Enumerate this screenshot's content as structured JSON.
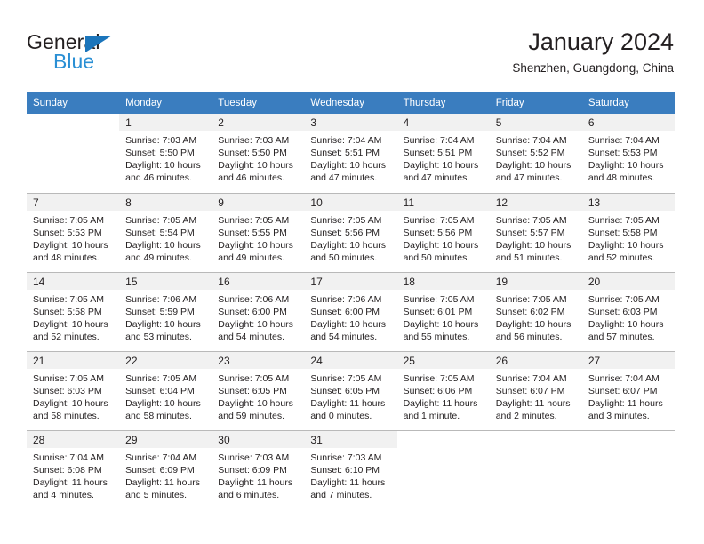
{
  "brand": {
    "name_dark": "General",
    "name_blue": "Blue",
    "accent_blue": "#2a8fd4",
    "triangle_blue": "#1b75bb"
  },
  "header": {
    "title": "January 2024",
    "location": "Shenzhen, Guangdong, China",
    "header_bg": "#3a7dbf",
    "daynum_bg": "#f1f1f1"
  },
  "weekdays": [
    "Sunday",
    "Monday",
    "Tuesday",
    "Wednesday",
    "Thursday",
    "Friday",
    "Saturday"
  ],
  "labels": {
    "sunrise_prefix": "Sunrise: ",
    "sunset_prefix": "Sunset: ",
    "daylight_prefix": "Daylight: "
  },
  "weeks": [
    [
      {
        "day": "",
        "sunrise": "",
        "sunset": "",
        "daylight": ""
      },
      {
        "day": "1",
        "sunrise": "Sunrise: 7:03 AM",
        "sunset": "Sunset: 5:50 PM",
        "daylight": "Daylight: 10 hours and 46 minutes."
      },
      {
        "day": "2",
        "sunrise": "Sunrise: 7:03 AM",
        "sunset": "Sunset: 5:50 PM",
        "daylight": "Daylight: 10 hours and 46 minutes."
      },
      {
        "day": "3",
        "sunrise": "Sunrise: 7:04 AM",
        "sunset": "Sunset: 5:51 PM",
        "daylight": "Daylight: 10 hours and 47 minutes."
      },
      {
        "day": "4",
        "sunrise": "Sunrise: 7:04 AM",
        "sunset": "Sunset: 5:51 PM",
        "daylight": "Daylight: 10 hours and 47 minutes."
      },
      {
        "day": "5",
        "sunrise": "Sunrise: 7:04 AM",
        "sunset": "Sunset: 5:52 PM",
        "daylight": "Daylight: 10 hours and 47 minutes."
      },
      {
        "day": "6",
        "sunrise": "Sunrise: 7:04 AM",
        "sunset": "Sunset: 5:53 PM",
        "daylight": "Daylight: 10 hours and 48 minutes."
      }
    ],
    [
      {
        "day": "7",
        "sunrise": "Sunrise: 7:05 AM",
        "sunset": "Sunset: 5:53 PM",
        "daylight": "Daylight: 10 hours and 48 minutes."
      },
      {
        "day": "8",
        "sunrise": "Sunrise: 7:05 AM",
        "sunset": "Sunset: 5:54 PM",
        "daylight": "Daylight: 10 hours and 49 minutes."
      },
      {
        "day": "9",
        "sunrise": "Sunrise: 7:05 AM",
        "sunset": "Sunset: 5:55 PM",
        "daylight": "Daylight: 10 hours and 49 minutes."
      },
      {
        "day": "10",
        "sunrise": "Sunrise: 7:05 AM",
        "sunset": "Sunset: 5:56 PM",
        "daylight": "Daylight: 10 hours and 50 minutes."
      },
      {
        "day": "11",
        "sunrise": "Sunrise: 7:05 AM",
        "sunset": "Sunset: 5:56 PM",
        "daylight": "Daylight: 10 hours and 50 minutes."
      },
      {
        "day": "12",
        "sunrise": "Sunrise: 7:05 AM",
        "sunset": "Sunset: 5:57 PM",
        "daylight": "Daylight: 10 hours and 51 minutes."
      },
      {
        "day": "13",
        "sunrise": "Sunrise: 7:05 AM",
        "sunset": "Sunset: 5:58 PM",
        "daylight": "Daylight: 10 hours and 52 minutes."
      }
    ],
    [
      {
        "day": "14",
        "sunrise": "Sunrise: 7:05 AM",
        "sunset": "Sunset: 5:58 PM",
        "daylight": "Daylight: 10 hours and 52 minutes."
      },
      {
        "day": "15",
        "sunrise": "Sunrise: 7:06 AM",
        "sunset": "Sunset: 5:59 PM",
        "daylight": "Daylight: 10 hours and 53 minutes."
      },
      {
        "day": "16",
        "sunrise": "Sunrise: 7:06 AM",
        "sunset": "Sunset: 6:00 PM",
        "daylight": "Daylight: 10 hours and 54 minutes."
      },
      {
        "day": "17",
        "sunrise": "Sunrise: 7:06 AM",
        "sunset": "Sunset: 6:00 PM",
        "daylight": "Daylight: 10 hours and 54 minutes."
      },
      {
        "day": "18",
        "sunrise": "Sunrise: 7:05 AM",
        "sunset": "Sunset: 6:01 PM",
        "daylight": "Daylight: 10 hours and 55 minutes."
      },
      {
        "day": "19",
        "sunrise": "Sunrise: 7:05 AM",
        "sunset": "Sunset: 6:02 PM",
        "daylight": "Daylight: 10 hours and 56 minutes."
      },
      {
        "day": "20",
        "sunrise": "Sunrise: 7:05 AM",
        "sunset": "Sunset: 6:03 PM",
        "daylight": "Daylight: 10 hours and 57 minutes."
      }
    ],
    [
      {
        "day": "21",
        "sunrise": "Sunrise: 7:05 AM",
        "sunset": "Sunset: 6:03 PM",
        "daylight": "Daylight: 10 hours and 58 minutes."
      },
      {
        "day": "22",
        "sunrise": "Sunrise: 7:05 AM",
        "sunset": "Sunset: 6:04 PM",
        "daylight": "Daylight: 10 hours and 58 minutes."
      },
      {
        "day": "23",
        "sunrise": "Sunrise: 7:05 AM",
        "sunset": "Sunset: 6:05 PM",
        "daylight": "Daylight: 10 hours and 59 minutes."
      },
      {
        "day": "24",
        "sunrise": "Sunrise: 7:05 AM",
        "sunset": "Sunset: 6:05 PM",
        "daylight": "Daylight: 11 hours and 0 minutes."
      },
      {
        "day": "25",
        "sunrise": "Sunrise: 7:05 AM",
        "sunset": "Sunset: 6:06 PM",
        "daylight": "Daylight: 11 hours and 1 minute."
      },
      {
        "day": "26",
        "sunrise": "Sunrise: 7:04 AM",
        "sunset": "Sunset: 6:07 PM",
        "daylight": "Daylight: 11 hours and 2 minutes."
      },
      {
        "day": "27",
        "sunrise": "Sunrise: 7:04 AM",
        "sunset": "Sunset: 6:07 PM",
        "daylight": "Daylight: 11 hours and 3 minutes."
      }
    ],
    [
      {
        "day": "28",
        "sunrise": "Sunrise: 7:04 AM",
        "sunset": "Sunset: 6:08 PM",
        "daylight": "Daylight: 11 hours and 4 minutes."
      },
      {
        "day": "29",
        "sunrise": "Sunrise: 7:04 AM",
        "sunset": "Sunset: 6:09 PM",
        "daylight": "Daylight: 11 hours and 5 minutes."
      },
      {
        "day": "30",
        "sunrise": "Sunrise: 7:03 AM",
        "sunset": "Sunset: 6:09 PM",
        "daylight": "Daylight: 11 hours and 6 minutes."
      },
      {
        "day": "31",
        "sunrise": "Sunrise: 7:03 AM",
        "sunset": "Sunset: 6:10 PM",
        "daylight": "Daylight: 11 hours and 7 minutes."
      },
      {
        "day": "",
        "sunrise": "",
        "sunset": "",
        "daylight": ""
      },
      {
        "day": "",
        "sunrise": "",
        "sunset": "",
        "daylight": ""
      },
      {
        "day": "",
        "sunrise": "",
        "sunset": "",
        "daylight": ""
      }
    ]
  ]
}
